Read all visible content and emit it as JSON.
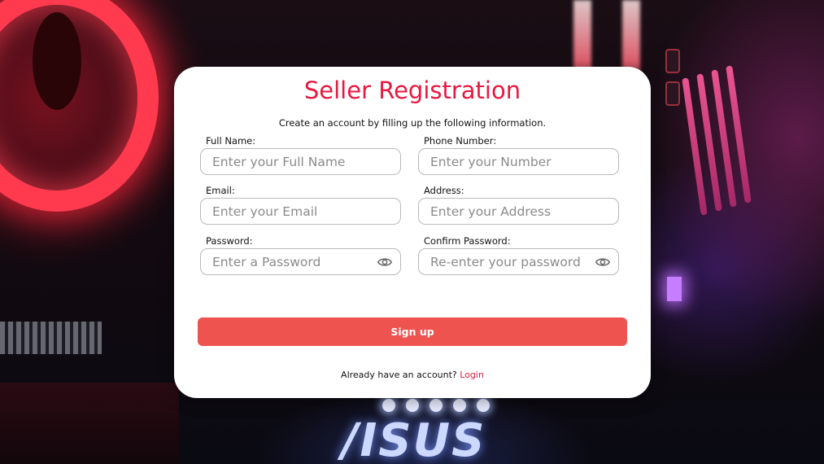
{
  "form": {
    "title": "Seller Registration",
    "subtitle": "Create an account by filling up the following information.",
    "fields": {
      "full_name": {
        "label": "Full Name:",
        "placeholder": "Enter your Full Name",
        "value": ""
      },
      "phone": {
        "label": "Phone Number:",
        "placeholder": "Enter your Number",
        "value": ""
      },
      "email": {
        "label": "Email:",
        "placeholder": "Enter your Email",
        "value": ""
      },
      "address": {
        "label": "Address:",
        "placeholder": "Enter your Address",
        "value": ""
      },
      "password": {
        "label": "Password:",
        "placeholder": "Enter a Password",
        "value": "",
        "icon": "eye-icon"
      },
      "confirm_password": {
        "label": "Confirm Password:",
        "placeholder": "Re-enter your password",
        "value": "",
        "icon": "eye-icon"
      }
    },
    "submit_label": "Sign up",
    "footer_text": "Already have an account?",
    "login_link": "Login"
  },
  "background": {
    "brand_logo_text": "/ISUS"
  },
  "colors": {
    "accent": "#e8183f",
    "button": "#ef5350",
    "card": "#ffffff"
  }
}
